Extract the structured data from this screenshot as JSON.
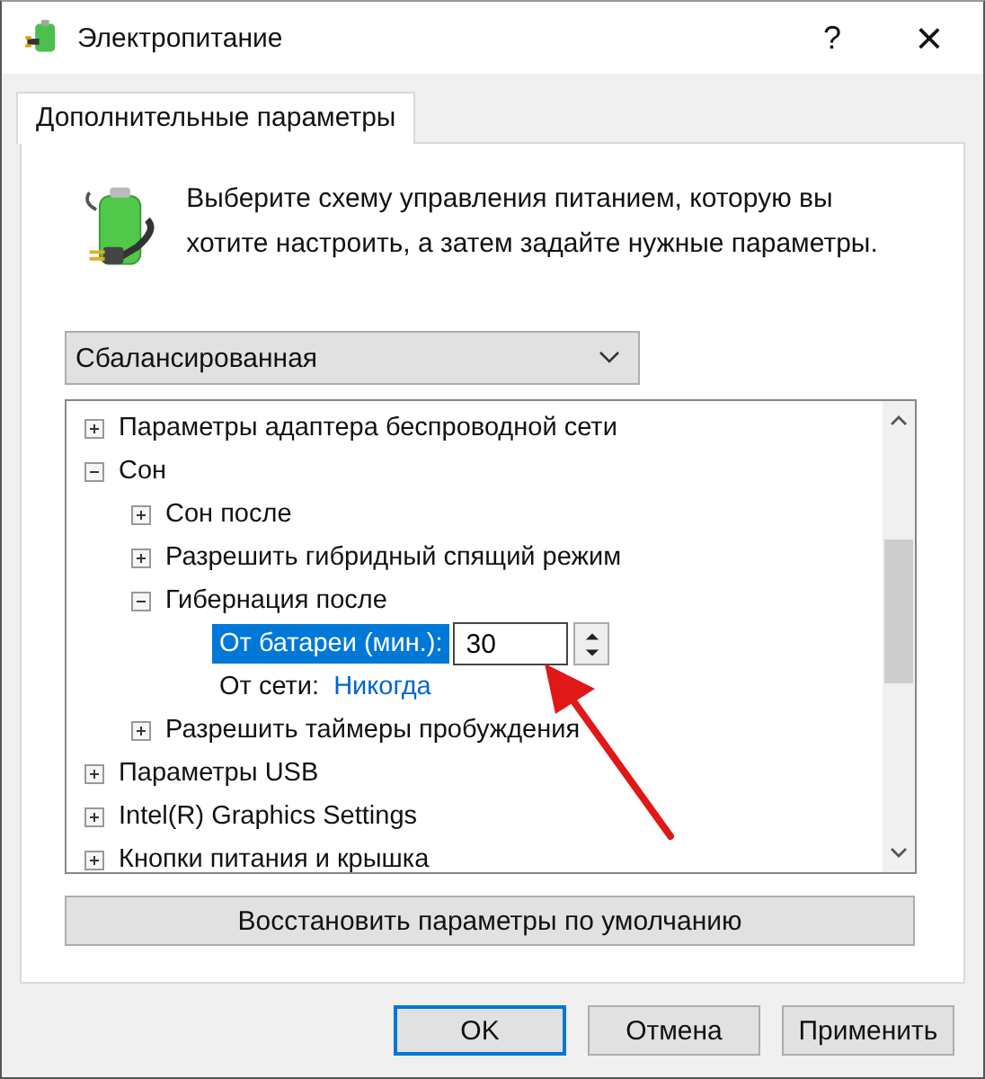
{
  "window": {
    "title": "Электропитание",
    "help": "?",
    "close": "×"
  },
  "tabs": [
    {
      "label": "Дополнительные параметры",
      "selected": true
    }
  ],
  "description": "Выберите схему управления питанием, которую вы хотите настроить, а затем задайте нужные параметры.",
  "plan_dropdown": {
    "value": "Сбалансированная"
  },
  "tree": [
    {
      "kind": "group",
      "label": "Параметры адаптера беспроводной сети",
      "expanded": false
    },
    {
      "kind": "group",
      "label": "Сон",
      "expanded": true,
      "children": [
        {
          "kind": "group",
          "label": "Сон после",
          "expanded": false
        },
        {
          "kind": "group",
          "label": "Разрешить гибридный спящий режим",
          "expanded": false
        },
        {
          "kind": "group",
          "label": "Гибернация после",
          "expanded": true,
          "children": [
            {
              "kind": "setting",
              "label": "От батареи (мин.):",
              "value": "30",
              "selected": true
            },
            {
              "kind": "setting",
              "label": "От сети:",
              "value": "Никогда",
              "selected": false
            }
          ]
        },
        {
          "kind": "group",
          "label": "Разрешить таймеры пробуждения",
          "expanded": false
        }
      ]
    },
    {
      "kind": "group",
      "label": "Параметры USB",
      "expanded": false
    },
    {
      "kind": "group",
      "label": "Intel(R) Graphics Settings",
      "expanded": false
    },
    {
      "kind": "group",
      "label": "Кнопки питания и крышка",
      "expanded": false
    }
  ],
  "restore_button": "Восстановить параметры по умолчанию",
  "buttons": [
    {
      "label": "OK",
      "default": true
    },
    {
      "label": "Отмена",
      "default": false
    },
    {
      "label": "Применить",
      "default": false
    }
  ]
}
